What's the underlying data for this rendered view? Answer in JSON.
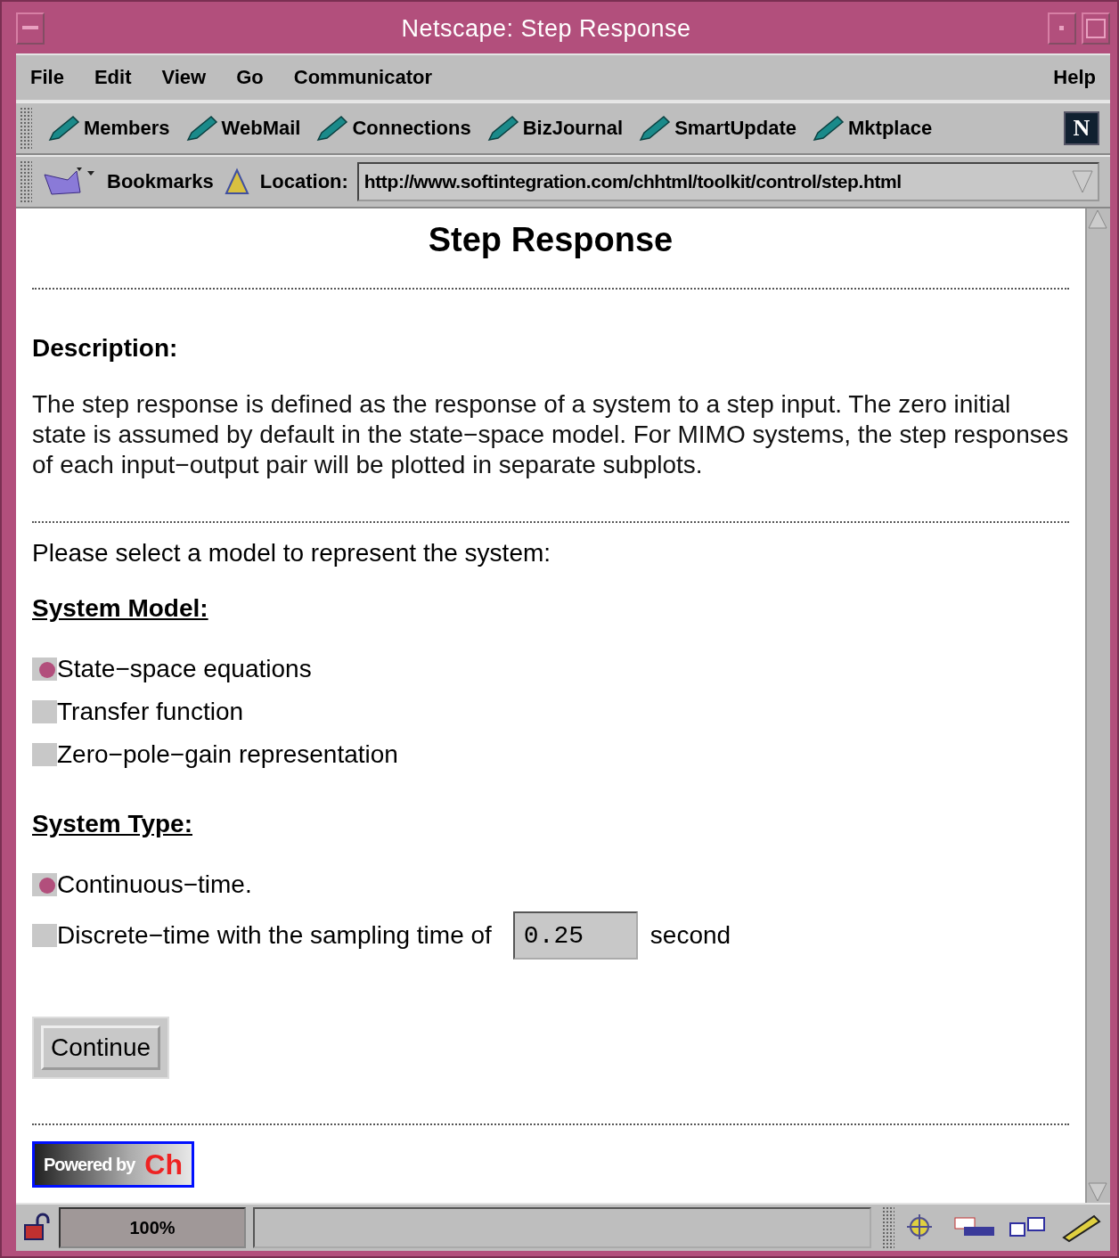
{
  "window": {
    "title": "Netscape: Step Response"
  },
  "menu": {
    "items": [
      "File",
      "Edit",
      "View",
      "Go",
      "Communicator"
    ],
    "help": "Help"
  },
  "toolbar": {
    "buttons": [
      "Members",
      "WebMail",
      "Connections",
      "BizJournal",
      "SmartUpdate",
      "Mktplace"
    ],
    "brand": "N"
  },
  "location": {
    "bookmarks": "Bookmarks",
    "label": "Location:",
    "url": "http://www.softintegration.com/chhtml/toolkit/control/step.html"
  },
  "page": {
    "title": "Step Response",
    "description_heading": "Description:",
    "description": "The step response is defined as the response of a system to a step input. The zero initial state is assumed by default in the state−space model. For MIMO systems, the step responses of each input−output pair will be plotted in separate subplots.",
    "prompt": "Please select a model to represent the system:",
    "model_heading": "System Model:",
    "model_options": [
      {
        "label": "State−space equations",
        "selected": true
      },
      {
        "label": "Transfer function",
        "selected": false
      },
      {
        "label": "Zero−pole−gain representation",
        "selected": false
      }
    ],
    "type_heading": "System Type:",
    "type_options": [
      {
        "label": "Continuous−time.",
        "selected": true
      },
      {
        "label": "Discrete−time with the sampling time of",
        "selected": false,
        "value": "0.25",
        "unit": "second"
      }
    ],
    "continue_button": "Continue",
    "badge": {
      "text": "Powered by",
      "mark": "Ch"
    }
  },
  "status": {
    "progress": "100%"
  }
}
